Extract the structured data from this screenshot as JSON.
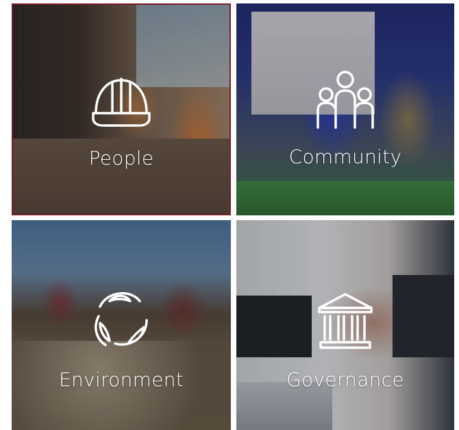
{
  "tiles": [
    {
      "label": "People",
      "icon": "hard-hat-icon"
    },
    {
      "label": "Community",
      "icon": "group-icon"
    },
    {
      "label": "Environment",
      "icon": "recycle-leaf-icon"
    },
    {
      "label": "Governance",
      "icon": "pillar-building-icon"
    }
  ],
  "colors": {
    "label": "#ffffff",
    "people_border": "#7a1d2a"
  }
}
